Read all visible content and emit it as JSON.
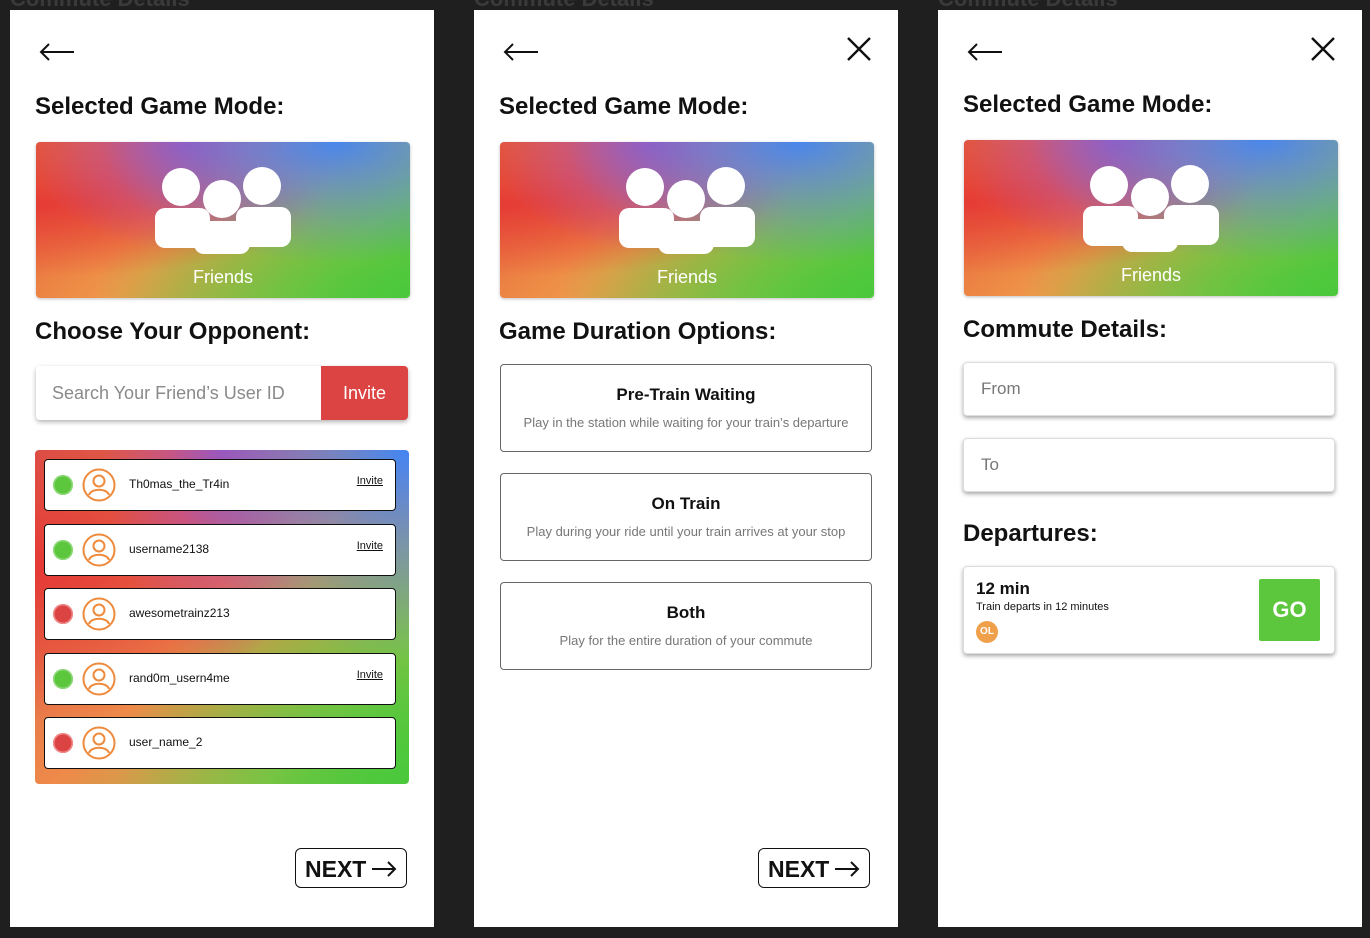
{
  "background_label": "Commute Details",
  "screens": [
    {
      "heading": "Selected Game Mode:",
      "mode_label": "Friends",
      "section_heading": "Choose Your Opponent:",
      "search": {
        "placeholder": "Search Your Friend’s User ID",
        "button_label": "Invite"
      },
      "friends": [
        {
          "username": "Th0mas_the_Tr4in",
          "online": true,
          "invite_label": "Invite"
        },
        {
          "username": "username2138",
          "online": true,
          "invite_label": "Invite"
        },
        {
          "username": "awesometrainz213",
          "online": false,
          "invite_label": ""
        },
        {
          "username": "rand0m_usern4me",
          "online": true,
          "invite_label": "Invite"
        },
        {
          "username": "user_name_2",
          "online": false,
          "invite_label": ""
        }
      ],
      "next_label": "NEXT"
    },
    {
      "heading": "Selected Game Mode:",
      "mode_label": "Friends",
      "section_heading": "Game Duration Options:",
      "options": [
        {
          "title": "Pre-Train Waiting",
          "description": "Play in the station while waiting for your train’s departure"
        },
        {
          "title": "On Train",
          "description": "Play during your ride until your train arrives at your stop"
        },
        {
          "title": "Both",
          "description": "Play for the entire duration of your commute"
        }
      ],
      "next_label": "NEXT"
    },
    {
      "heading": "Selected Game Mode:",
      "mode_label": "Friends",
      "section_heading": "Commute Details:",
      "from_placeholder": "From",
      "to_placeholder": "To",
      "departures_heading": "Departures:",
      "departure": {
        "time": "12 min",
        "subtitle": "Train departs in 12 minutes",
        "line": "OL",
        "go_label": "GO"
      }
    }
  ],
  "colors": {
    "online": "#5cc63c",
    "offline": "#dc4343",
    "invite": "#dc4343",
    "go": "#5cc63c",
    "line_badge": "#f0a04a",
    "avatar_stroke": "#ee8a3c"
  },
  "icons": {
    "back": "arrow-left-icon",
    "close": "close-icon",
    "mode": "group-icon",
    "avatar": "user-avatar-icon",
    "next": "arrow-right-icon"
  }
}
